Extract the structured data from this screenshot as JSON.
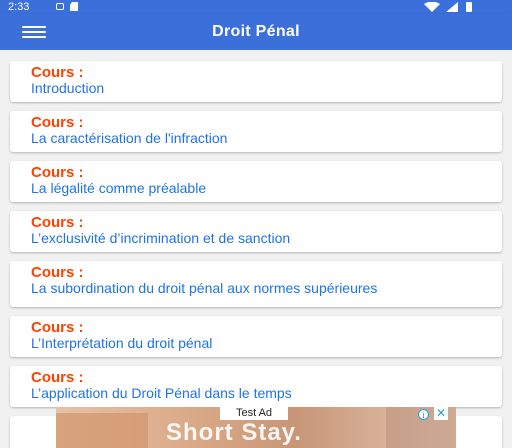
{
  "status_bar": {
    "time": "2:33"
  },
  "app_bar": {
    "title": "Droit Pénal"
  },
  "cards": [
    {
      "heading": "Cours :",
      "text": "Introduction"
    },
    {
      "heading": "Cours :",
      "text": "La caractérisation de l'infraction"
    },
    {
      "heading": "Cours :",
      "text": "La légalité comme préalable"
    },
    {
      "heading": "Cours :",
      "text": "L’exclusivité d’incrimination et de sanction"
    },
    {
      "heading": "Cours :",
      "text": "La subordination du droit pénal aux normes supérieures"
    },
    {
      "heading": "Cours :",
      "text": "L’Interprétation du droit pénal"
    },
    {
      "heading": "Cours :",
      "text": "L’application du Droit Pénal dans le temps"
    }
  ],
  "ad": {
    "label": "Test Ad",
    "text": "Short Stay.",
    "info_glyph": "i",
    "close_glyph": "✕"
  },
  "colors": {
    "primary": "#3b6fd9",
    "heading": "#ff4200",
    "link": "#1f73e6"
  }
}
